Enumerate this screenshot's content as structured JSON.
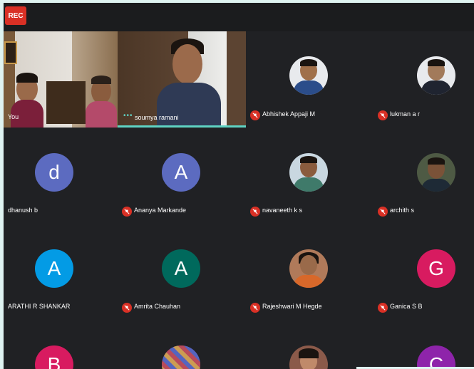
{
  "recording_badge": "REC",
  "self_tile": {
    "name": "You"
  },
  "speaker_tile": {
    "name": "soumya ramani"
  },
  "participants": [
    {
      "name": "Abhishek Appaji M",
      "initial": "",
      "avatar_color": "#e8eaed",
      "muted": true
    },
    {
      "name": "lukman a r",
      "initial": "",
      "avatar_color": "#e8eaed",
      "muted": true
    },
    {
      "name": "dhanush b",
      "initial": "d",
      "avatar_color": "#5c6bc0",
      "muted": true
    },
    {
      "name": "Ananya Markande",
      "initial": "A",
      "avatar_color": "#5c6bc0",
      "muted": true
    },
    {
      "name": "navaneeth k s",
      "initial": "",
      "avatar_color": "#c9d7e0",
      "muted": true
    },
    {
      "name": "archith s",
      "initial": "",
      "avatar_color": "#4e5a44",
      "muted": true
    },
    {
      "name": "ARATHI R SHANKAR",
      "initial": "A",
      "avatar_color": "#039be5",
      "muted": true
    },
    {
      "name": "Amrita Chauhan",
      "initial": "A",
      "avatar_color": "#00695c",
      "muted": true
    },
    {
      "name": "Rajeshwari M Hegde",
      "initial": "",
      "avatar_color": "#b07a5a",
      "muted": true
    },
    {
      "name": "Ganica S B",
      "initial": "G",
      "avatar_color": "#d81b60",
      "muted": true
    },
    {
      "name": "",
      "initial": "B",
      "avatar_color": "#d81b60",
      "muted": true
    },
    {
      "name": "",
      "initial": "",
      "avatar_color": "#7b4f9e",
      "muted": true
    },
    {
      "name": "",
      "initial": "",
      "avatar_color": "#8b5a4a",
      "muted": true
    },
    {
      "name": "",
      "initial": "C",
      "avatar_color": "#8e24aa",
      "muted": true
    }
  ]
}
